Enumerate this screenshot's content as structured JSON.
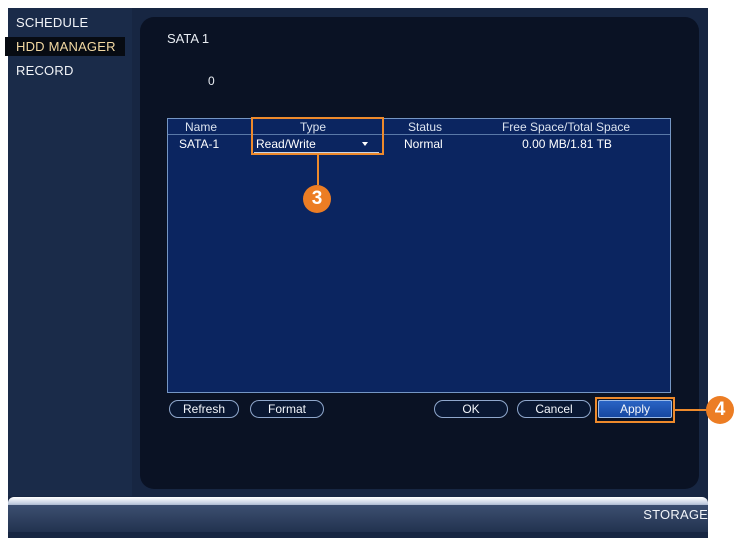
{
  "sidebar": {
    "items": [
      {
        "label": "SCHEDULE",
        "active": false
      },
      {
        "label": "HDD MANAGER",
        "active": true
      },
      {
        "label": "RECORD",
        "active": false
      }
    ]
  },
  "main": {
    "title": "SATA  1",
    "disk_index": "0",
    "table": {
      "columns": [
        "Name",
        "Type",
        "Status",
        "Free Space/Total Space"
      ],
      "rows": [
        {
          "name": "SATA-1",
          "type": "Read/Write",
          "status": "Normal",
          "space": "0.00 MB/1.81 TB"
        }
      ]
    },
    "buttons": {
      "refresh": "Refresh",
      "format": "Format",
      "ok": "OK",
      "cancel": "Cancel",
      "apply": "Apply"
    }
  },
  "callouts": {
    "step3": "3",
    "step4": "4",
    "accent_color": "#ee8a2c"
  },
  "footer": {
    "section_label": "STORAGE"
  },
  "colors": {
    "panel_bg": "#0a1224",
    "table_bg": "#0b2560",
    "active_sidebar_text": "#f3d9a2",
    "apply_button": "#1f56b4"
  }
}
